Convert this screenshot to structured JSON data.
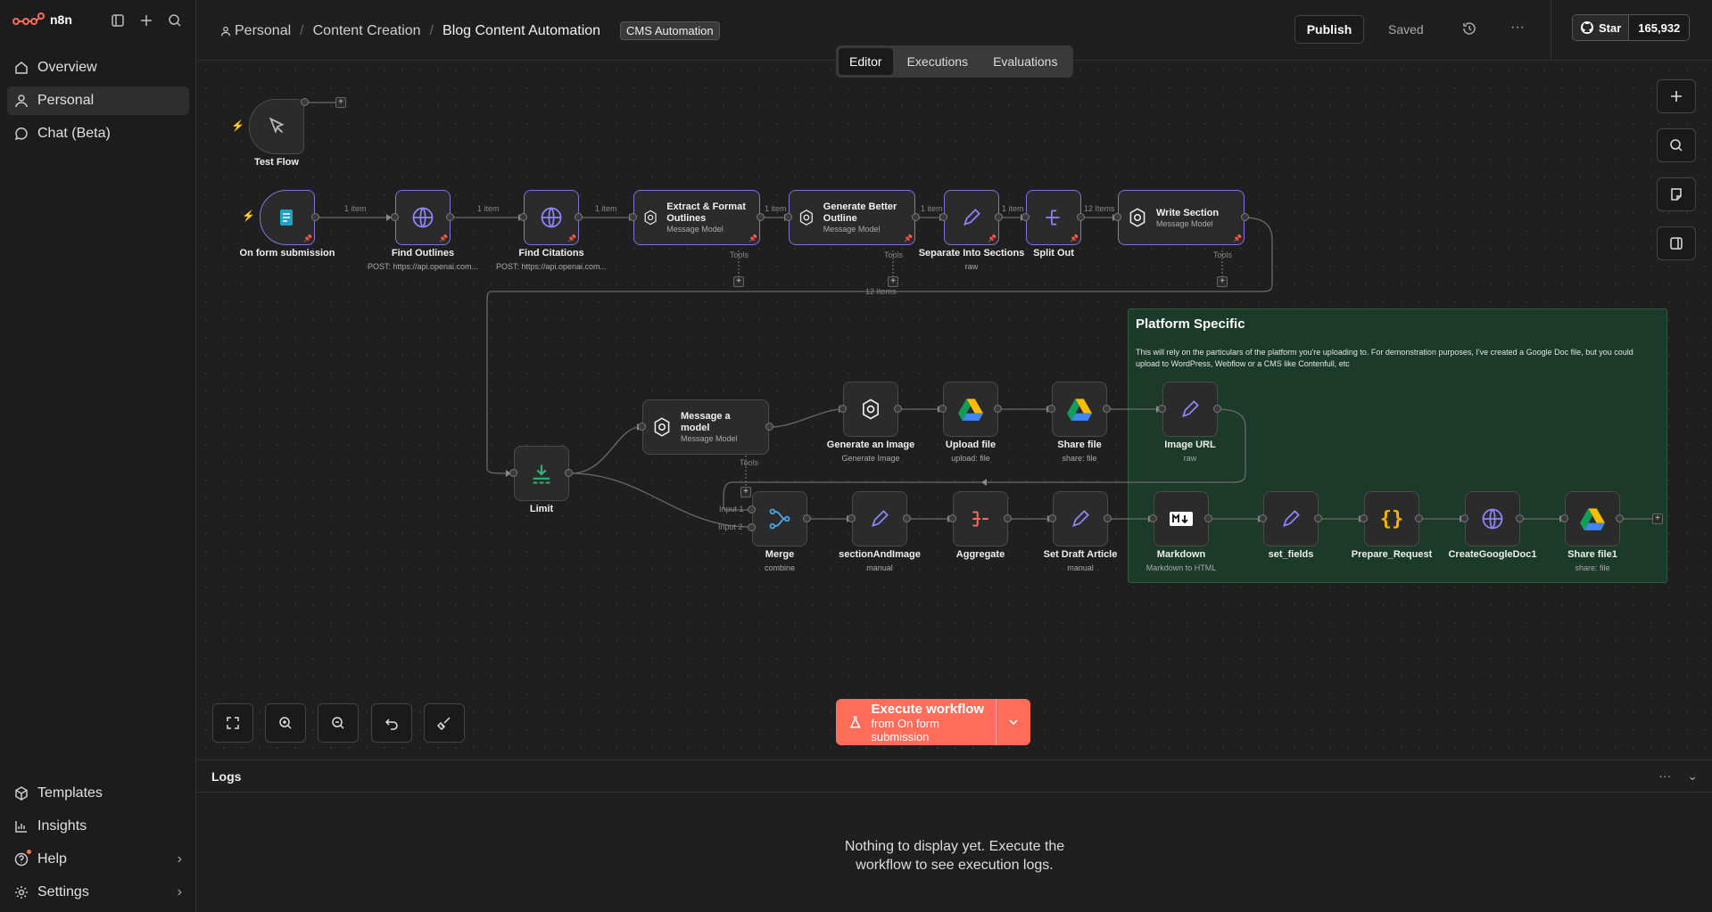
{
  "app": {
    "name": "n8n"
  },
  "sidebar": {
    "items": [
      {
        "label": "Overview"
      },
      {
        "label": "Personal"
      },
      {
        "label": "Chat (Beta)"
      }
    ],
    "bottom": [
      {
        "label": "Templates"
      },
      {
        "label": "Insights"
      },
      {
        "label": "Help"
      },
      {
        "label": "Settings"
      }
    ]
  },
  "header": {
    "breadcrumb": [
      "Personal",
      "Content Creation",
      "Blog Content Automation"
    ],
    "tag": "CMS Automation",
    "publish": "Publish",
    "saved": "Saved",
    "star": "Star",
    "star_count": "165,932"
  },
  "tabs": [
    {
      "label": "Editor",
      "active": true
    },
    {
      "label": "Executions",
      "active": false
    },
    {
      "label": "Evaluations",
      "active": false
    }
  ],
  "nodes": {
    "test_flow": "Test Flow",
    "form": "On form submission",
    "find_outlines": {
      "label": "Find Outlines",
      "sub": "POST: https://api.openai.com..."
    },
    "find_citations": {
      "label": "Find Citations",
      "sub": "POST: https://api.openai.com..."
    },
    "extract": {
      "title": "Extract & Format Outlines",
      "sub": "Message Model"
    },
    "better": {
      "title": "Generate Better Outline",
      "sub": "Message Model"
    },
    "separate": {
      "label": "Separate Into Sections",
      "sub": "raw"
    },
    "split": {
      "label": "Split Out"
    },
    "write": {
      "title": "Write Section",
      "sub": "Message Model"
    },
    "limit": {
      "label": "Limit"
    },
    "msg_model": {
      "title": "Message a model",
      "sub": "Message Model"
    },
    "gen_image": {
      "label": "Generate an Image",
      "sub": "Generate Image"
    },
    "upload": {
      "label": "Upload file",
      "sub": "upload: file"
    },
    "share": {
      "label": "Share file",
      "sub": "share: file"
    },
    "image_url": {
      "label": "Image URL",
      "sub": "raw"
    },
    "merge": {
      "label": "Merge",
      "sub": "combine"
    },
    "section_image": {
      "label": "sectionAndImage",
      "sub": "manual"
    },
    "aggregate": {
      "label": "Aggregate"
    },
    "draft": {
      "label": "Set Draft Article",
      "sub": "manual"
    },
    "markdown": {
      "label": "Markdown",
      "sub": "Markdown to HTML"
    },
    "set_fields": {
      "label": "set_fields"
    },
    "prepare": {
      "label": "Prepare_Request"
    },
    "create_doc": {
      "label": "CreateGoogleDoc1"
    },
    "share1": {
      "label": "Share file1",
      "sub": "share: file"
    }
  },
  "edge_labels": {
    "item": "1 item",
    "items12": "12 Items",
    "items12b": "12 Items",
    "tools": "Tools",
    "input1": "Input 1",
    "input2": "Input 2"
  },
  "sticky": {
    "title": "Platform Specific",
    "body": "This will rely on the particulars of the platform you're uploading to. For demonstration purposes, I've created a Google Doc file, but you could upload to WordPress, Webflow or a CMS like Contenfull, etc"
  },
  "execute": {
    "title": "Execute workflow",
    "sub": "from On form submission"
  },
  "logs": {
    "title": "Logs",
    "empty_line1": "Nothing to display yet. Execute the",
    "empty_line2": "workflow to see execution logs."
  },
  "colors": {
    "accent": "#ff6d5a",
    "selected": "#7c75d8",
    "sticky": "#1b3a2a"
  }
}
